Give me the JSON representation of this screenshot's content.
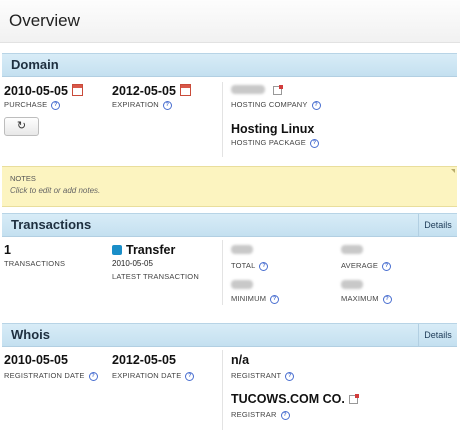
{
  "header": {
    "title": "Overview"
  },
  "domain": {
    "title": "Domain",
    "purchase_date": "2010-05-05",
    "purchase_label": "PURCHASE",
    "expiration_date": "2012-05-05",
    "expiration_label": "EXPIRATION",
    "hosting_company_label": "HOSTING COMPANY",
    "hosting_package_value": "Hosting Linux",
    "hosting_package_label": "HOSTING PACKAGE",
    "refresh_icon": "refresh-icon"
  },
  "notes": {
    "title": "NOTES",
    "placeholder": "Click to edit or add notes."
  },
  "transactions": {
    "title": "Transactions",
    "details_label": "Details",
    "count": "1",
    "count_label": "TRANSACTIONS",
    "latest_type": "Transfer",
    "latest_date": "2010-05-05",
    "latest_label": "LATEST TRANSACTION",
    "total_label": "TOTAL",
    "average_label": "AVERAGE",
    "minimum_label": "MINIMUM",
    "maximum_label": "MAXIMUM",
    "transfer_color": "#1a8ec8"
  },
  "whois": {
    "title": "Whois",
    "details_label": "Details",
    "registration_date": "2010-05-05",
    "registration_label": "REGISTRATION DATE",
    "expiration_date": "2012-05-05",
    "expiration_label": "EXPIRATION DATE",
    "registrant_value": "n/a",
    "registrant_label": "REGISTRANT",
    "registrar_value": "TUCOWS.COM CO.",
    "registrar_label": "REGISTRAR"
  },
  "colors": {
    "section_header_bg": "#c4e0f0",
    "notes_bg": "#fcf4c0",
    "help_icon": "#4a6fd0"
  }
}
